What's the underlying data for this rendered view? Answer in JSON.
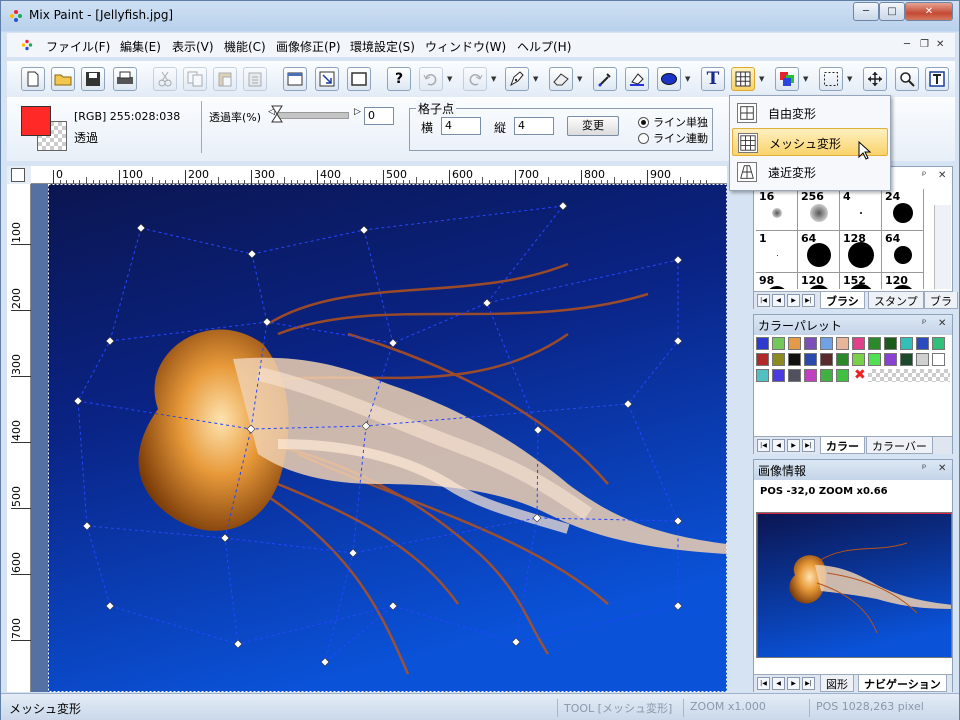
{
  "window": {
    "title": "Mix Paint - [Jellyfish.jpg]",
    "controls": {
      "minimize": "─",
      "maximize": "□",
      "close": "✕"
    }
  },
  "menu": {
    "items": [
      "ファイル(F)",
      "編集(E)",
      "表示(V)",
      "機能(C)",
      "画像修正(P)",
      "環境設定(S)",
      "ウィンドウ(W)",
      "ヘルプ(H)"
    ],
    "mdi": {
      "minimize": "─",
      "restore": "❐",
      "close": "✕"
    }
  },
  "toolbar": {
    "icons": [
      "new-file-icon",
      "open-folder-icon",
      "save-icon",
      "print-icon",
      "cut-icon",
      "copy-icon",
      "paste-icon",
      "paste-new-icon",
      "resize-canvas-icon",
      "resize-image-icon",
      "frame-icon",
      "help-icon",
      "undo-icon",
      "redo-icon",
      "pen-tool-icon",
      "eraser-icon",
      "dropper-icon",
      "fill-icon",
      "ellipse-icon",
      "text-icon",
      "mesh-transform-icon",
      "color-icon",
      "selection-icon",
      "move-icon",
      "zoom-icon",
      "text-box-icon"
    ],
    "help_glyph": "?",
    "text_glyph": "T"
  },
  "properties": {
    "color_value": "[RGB] 255:028:038",
    "transparency_label": "透過",
    "opacity_label": "透過率(%)",
    "opacity_value": "0",
    "opacity_slider_fraction": 0,
    "grid_group_label": "格子点",
    "horizontal_label": "横",
    "horizontal_value": "4",
    "vertical_label": "縦",
    "vertical_value": "4",
    "change_button": "変更",
    "radio_single": "ライン単独",
    "radio_linked": "ライン連動",
    "foreground_color": "#ff2a27"
  },
  "dropdown": {
    "items": [
      {
        "label": "自由変形",
        "icon": "free-transform-icon"
      },
      {
        "label": "メッシュ変形",
        "icon": "mesh-transform-icon",
        "highlighted": true
      },
      {
        "label": "遠近変形",
        "icon": "perspective-transform-icon"
      }
    ]
  },
  "rulers": {
    "top": [
      "0",
      "100",
      "200",
      "300",
      "400",
      "500",
      "600",
      "700",
      "800",
      "900"
    ],
    "left": [
      "100",
      "200",
      "300",
      "400",
      "500",
      "600",
      "700"
    ]
  },
  "brush_panel": {
    "sizes": [
      "16",
      "256",
      "4",
      "24",
      "1",
      "64",
      "128",
      "64",
      "98",
      "120",
      "152",
      "120"
    ],
    "tabs": [
      "ブラシ",
      "スタンプ",
      "ブラ"
    ]
  },
  "color_palette": {
    "title": "カラーパレット",
    "tabs": [
      "カラー",
      "カラーバー"
    ],
    "colors": [
      "#2e3bd0",
      "#74c85a",
      "#e49a46",
      "#7b4fb6",
      "#6fa1e4",
      "#e8b49a",
      "#e0408a",
      "#2a8a2a",
      "#1a5a1a",
      "#30c0b8",
      "#2a4ac0",
      "#30c07a",
      "#b02a2a",
      "#8a8a20",
      "#111111",
      "#2a4ab0",
      "#5a2a2a",
      "#2a8a2a",
      "#7ad04a",
      "#50e050",
      "#8a40d0",
      "#1a4a2a",
      "#d0d0d0",
      "#ffffff",
      "#50c0c0",
      "#4a3ae0",
      "#505060",
      "#c040c0",
      "#40b040",
      "#40c040"
    ]
  },
  "image_info": {
    "title": "画像情報",
    "pos_text": "POS -32,0 ZOOM x0.66",
    "tabs": [
      "図形",
      "ナビゲーション"
    ]
  },
  "status": {
    "left": "メッシュ変形",
    "tool": "TOOL [メッシュ変形]",
    "zoom": "ZOOM x1.000",
    "pos": "POS 1028,263 pixel"
  }
}
